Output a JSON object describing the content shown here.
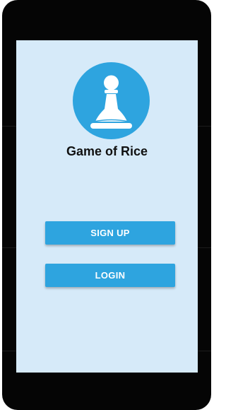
{
  "app": {
    "title": "Game of Rice",
    "logo_icon": "chess-pawn-icon"
  },
  "actions": {
    "signup_label": "SIGN UP",
    "login_label": "LOGIN"
  },
  "colors": {
    "accent": "#2ea4df",
    "screen_background": "#d6eaf9",
    "device_frame": "#050505"
  }
}
